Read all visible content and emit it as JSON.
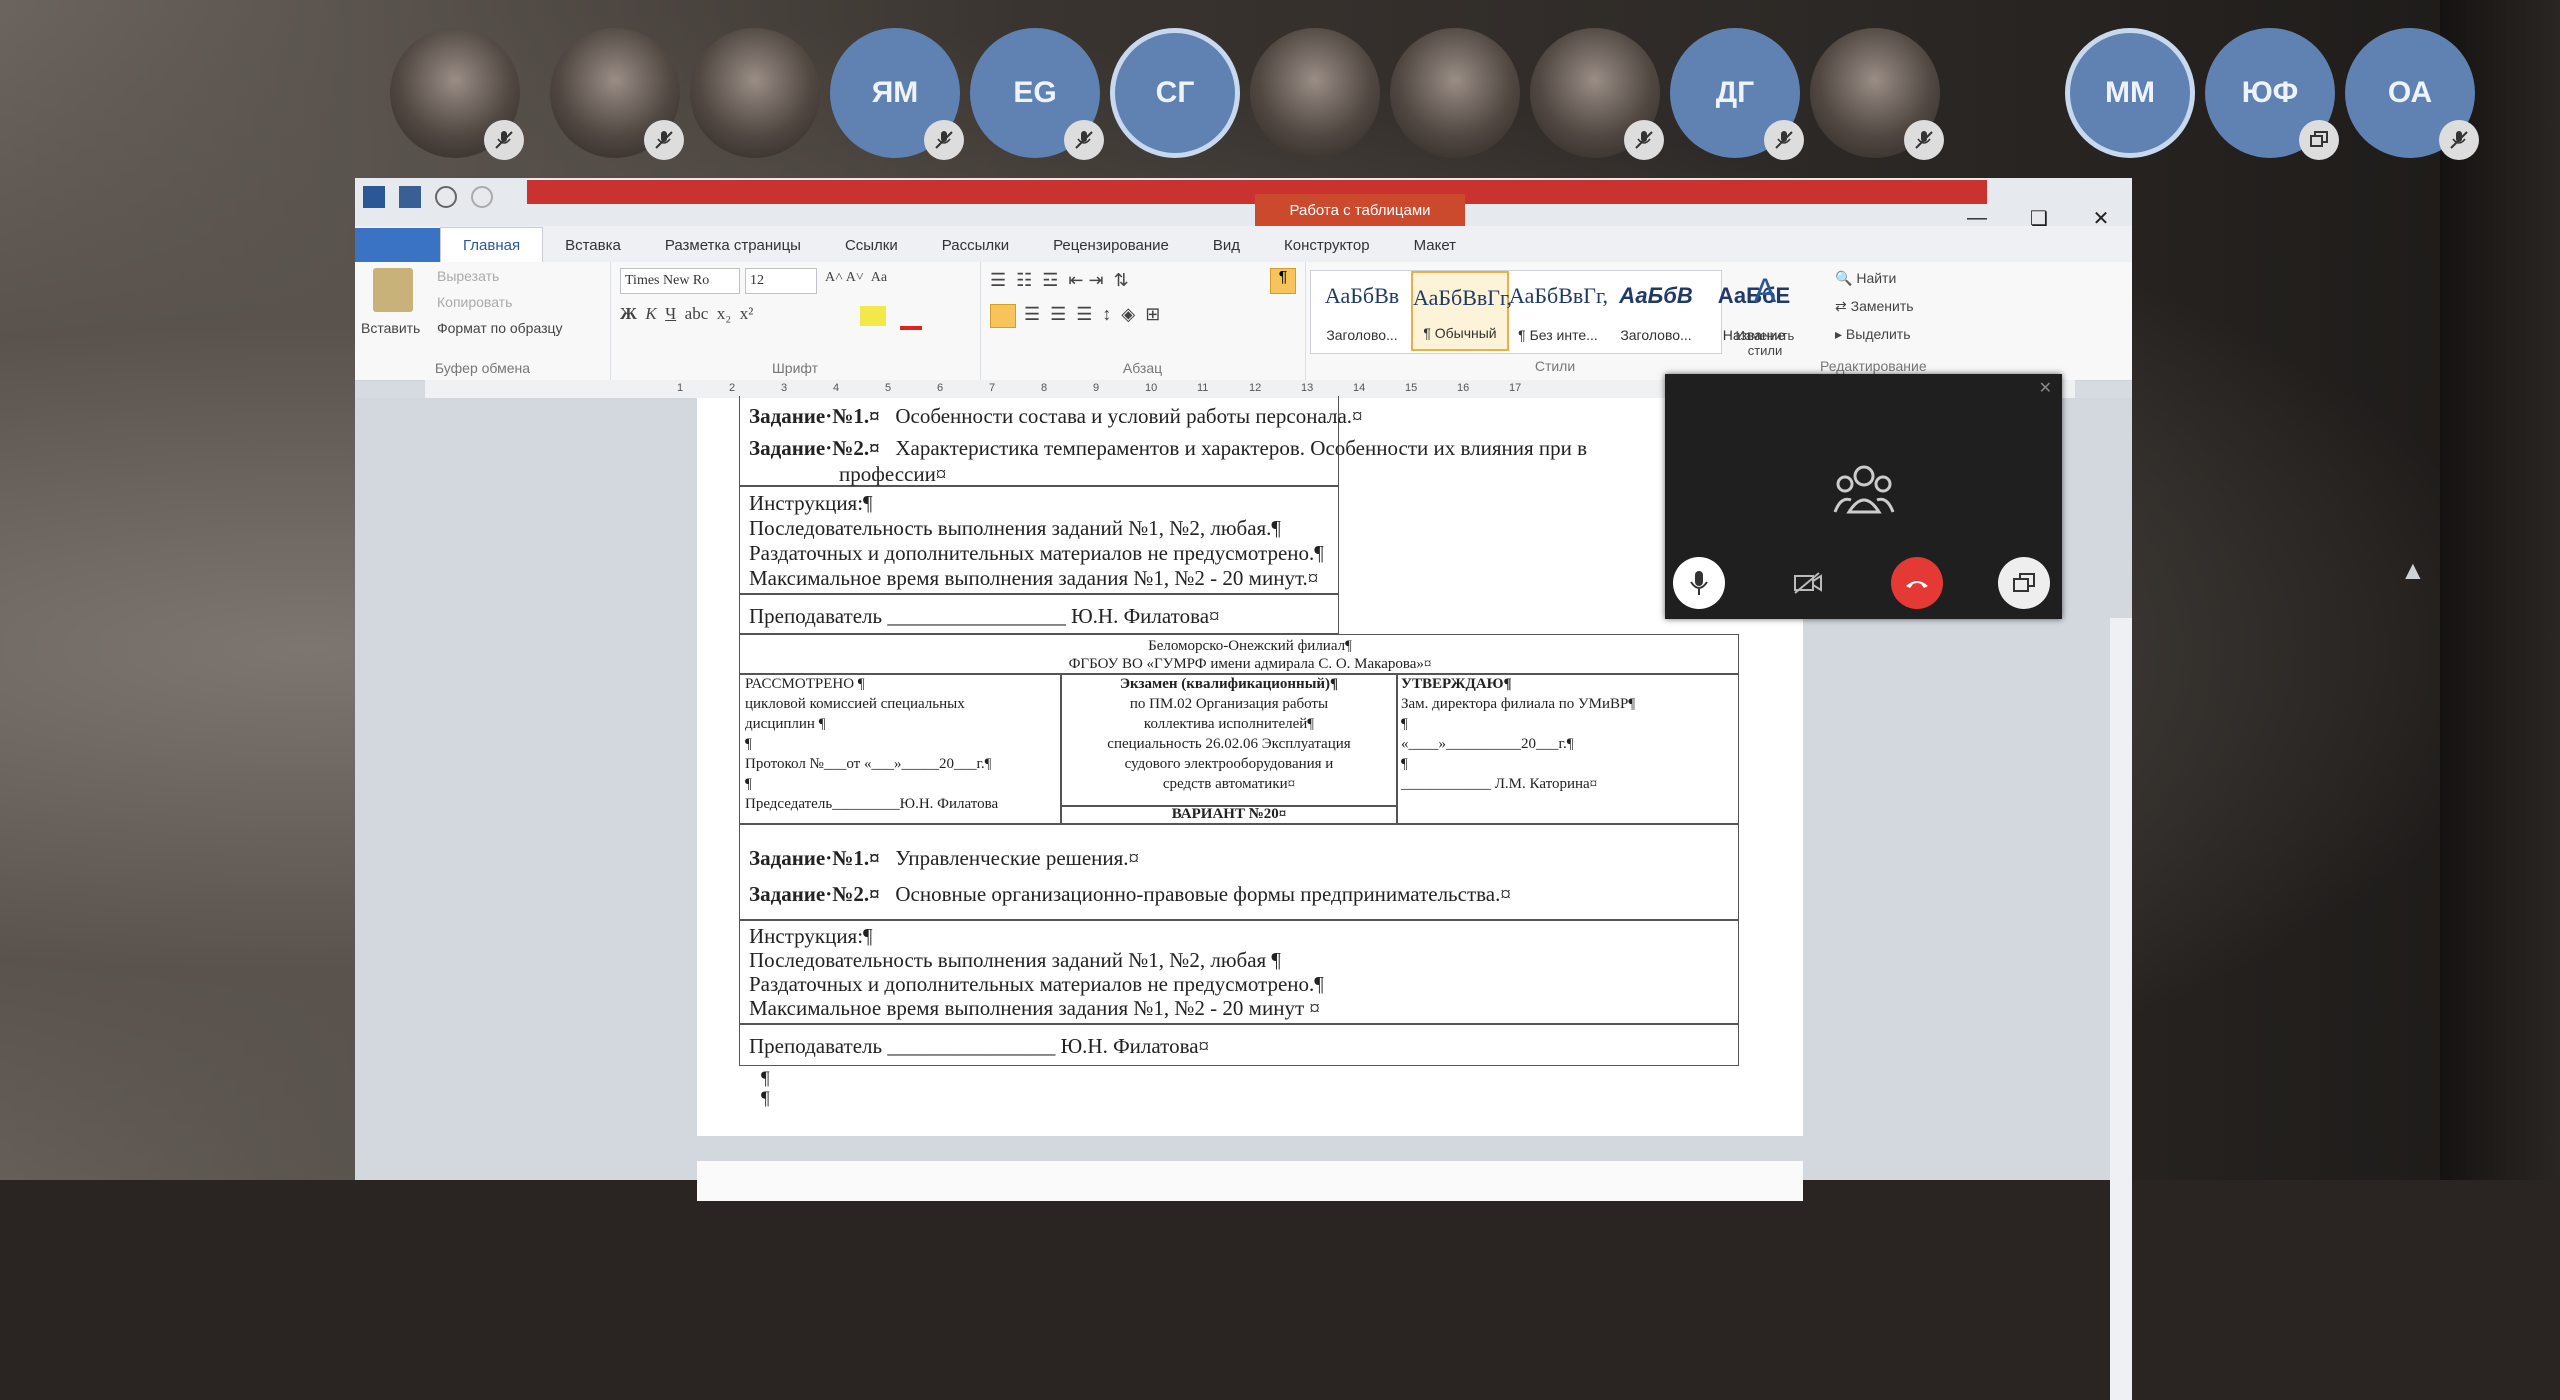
{
  "participants": [
    {
      "type": "camera",
      "muted": true
    },
    {
      "type": "camera",
      "muted": true
    },
    {
      "type": "camera",
      "muted": false
    },
    {
      "type": "initials",
      "label": "ЯМ",
      "muted": true
    },
    {
      "type": "initials",
      "label": "EG",
      "muted": true
    },
    {
      "type": "initials",
      "label": "СГ",
      "muted": false,
      "selected": true
    },
    {
      "type": "camera",
      "muted": false
    },
    {
      "type": "camera",
      "muted": false
    },
    {
      "type": "camera",
      "muted": true
    },
    {
      "type": "initials",
      "label": "ДГ",
      "muted": true
    },
    {
      "type": "camera",
      "muted": true
    },
    {
      "type": "initials",
      "label": "ММ",
      "muted": false,
      "selected": true
    },
    {
      "type": "initials",
      "label": "ЮФ",
      "muted": false,
      "screen": true
    },
    {
      "type": "initials",
      "label": "ОА",
      "muted": true
    }
  ],
  "word": {
    "table_tools": "Работа с таблицами",
    "tabs": [
      "Главная",
      "Вставка",
      "Разметка страницы",
      "Ссылки",
      "Рассылки",
      "Рецензирование",
      "Вид",
      "Конструктор",
      "Макет"
    ],
    "clipboard": {
      "paste": "Вставить",
      "cut": "Вырезать",
      "copy": "Копировать",
      "format": "Формат по образцу",
      "group": "Буфер обмена"
    },
    "font": {
      "name": "Times New Ro",
      "size": "12",
      "group": "Шрифт"
    },
    "paragraph": {
      "group": "Абзац"
    },
    "styles": {
      "items": [
        {
          "preview": "АаБбВв",
          "name": "Заголово..."
        },
        {
          "preview": "АаБбВвГг,",
          "name": "¶ Обычный"
        },
        {
          "preview": "АаБбВвГг,",
          "name": "¶ Без инте..."
        },
        {
          "preview": "АаБбВ",
          "name": "Заголово..."
        },
        {
          "preview": "АаБбЕ",
          "name": "Название"
        }
      ],
      "change": "Изменить стили",
      "group": "Стили"
    },
    "editing": {
      "find": "Найти",
      "replace": "Заменить",
      "select": "Выделить",
      "group": "Редактирование"
    }
  },
  "document": {
    "block1": {
      "task1_label": "Задание·№1.¤",
      "task1_text": "Особенности состава и условий работы персонала.¤",
      "task2_label": "Задание·№2.¤",
      "task2_text": "Характеристика темпераментов и характеров. Особенности их влияния при в",
      "task2_text2": "профессии¤",
      "instr": [
        "Инструкция:¶",
        "Последовательность выполнения заданий №1, №2, любая.¶",
        "Раздаточных и дополнительных материалов не предусмотрено.¶",
        "Максимальное время выполнения задания №1, №2 - 20 минут.¤"
      ],
      "teacher": "Преподаватель _________________ Ю.Н. Филатова¤"
    },
    "header": {
      "line1": "Беломорско-Онежский филиал¶",
      "line2": "ФГБОУ ВО «ГУМРФ имени адмирала С. О. Макарова»¤"
    },
    "left": [
      "РАССМОТРЕНО ¶",
      "цикловой комиссией специальных",
      "дисциплин ¶",
      "¶",
      "Протокол №___от «___»_____20___г.¶",
      "¶",
      "Председатель_________Ю.Н. Филатова"
    ],
    "center": [
      "Экзамен (квалификационный)¶",
      "по ПМ.02 Организация работы",
      "коллектива исполнителей¶",
      "специальность 26.02.06 Эксплуатация",
      "судового электрооборудования и",
      "средств автоматики¤"
    ],
    "variant": "ВАРИАНТ №20¤",
    "right": [
      "УТВЕРЖДАЮ¶",
      "Зам. директора филиала по УМиВР¶",
      "¶",
      "«____»__________20___г.¶",
      "¶",
      "____________ Л.М. Каторина¤"
    ],
    "block2": {
      "task1_label": "Задание·№1.¤",
      "task1_text": "Управленческие решения.¤",
      "task2_label": "Задание·№2.¤",
      "task2_text": "Основные организационно-правовые формы предпринимательства.¤",
      "instr": [
        "Инструкция:¶",
        "Последовательность выполнения заданий №1, №2, любая ¶",
        "Раздаточных и дополнительных материалов не предусмотрено.¶",
        "Максимальное время выполнения задания №1, №2 - 20 минут ¤"
      ],
      "teacher": "Преподаватель ________________ Ю.Н. Филатова¤"
    },
    "end_marks": [
      "¶",
      "¶"
    ]
  },
  "colors": {
    "accent": "#2b5797",
    "hangup": "#e53935",
    "title_red": "#c9322f",
    "initials_bg": "#5f82b3"
  }
}
